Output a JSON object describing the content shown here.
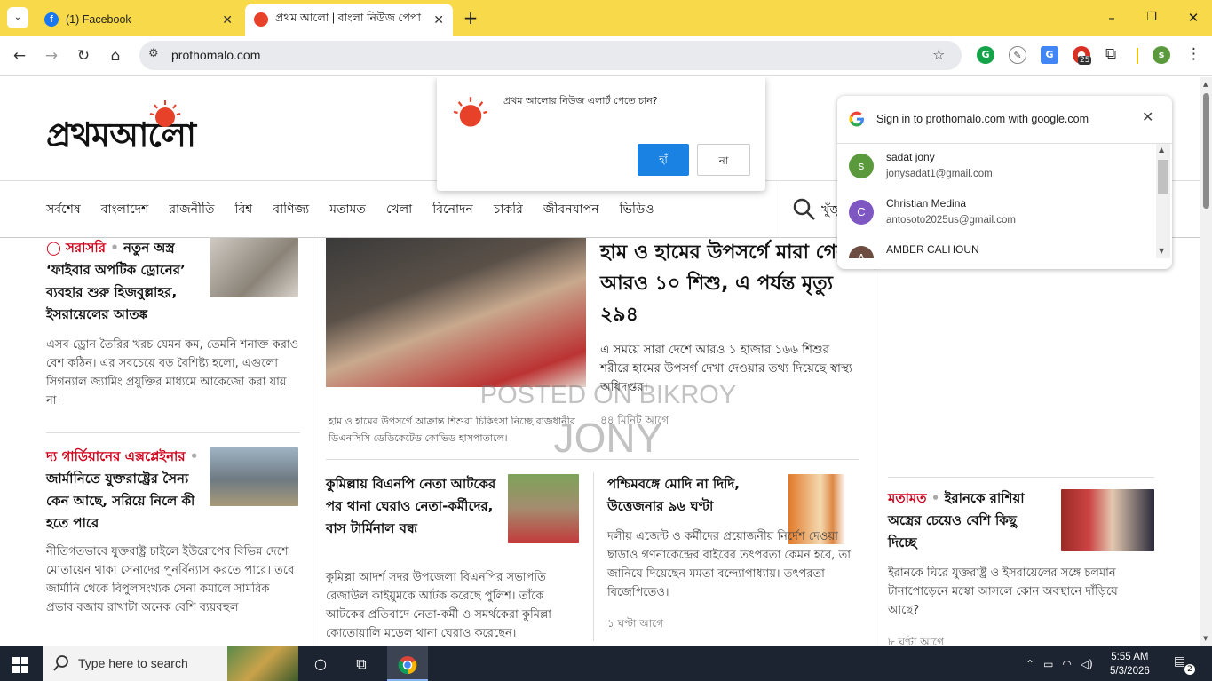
{
  "browser": {
    "tabs": [
      {
        "title": "(1) Facebook",
        "active": false
      },
      {
        "title": "প্রথম আলো | বাংলা নিউজ পেপা",
        "active": true
      }
    ],
    "url": "prothomalo.com",
    "profile_initial": "s",
    "ext_badge": "25"
  },
  "site": {
    "logo": "প্রথমআলো",
    "nav": [
      "সর্বশেষ",
      "বাংলাদেশ",
      "রাজনীতি",
      "বিশ্ব",
      "বাণিজ্য",
      "মতামত",
      "খেলা",
      "বিনোদন",
      "চাকরি",
      "জীবনযাপন",
      "ভিডিও"
    ],
    "search_label": "খুঁজু"
  },
  "notification": {
    "text": "প্রথম আলোর নিউজ এলার্ট পেতে চান?",
    "yes": "হাঁ",
    "no": "না"
  },
  "google_signin": {
    "title": "Sign in to prothomalo.com with google.com",
    "accounts": [
      {
        "initial": "s",
        "name": "sadat jony",
        "email": "jonysadat1@gmail.com",
        "color": "#5b9a3c"
      },
      {
        "initial": "C",
        "name": "Christian Medina",
        "email": "antosoto2025us@gmail.com",
        "color": "#7e57c2"
      },
      {
        "initial": "A",
        "name": "AMBER CALHOUN",
        "email": "",
        "color": "#6d4c41"
      }
    ]
  },
  "articles": {
    "left1": {
      "tag": "সরাসরি",
      "headline": "নতুন অস্ত্র ‘ফাইবার অপটিক ড্রোনের’ ব্যবহার শুরু হিজবুল্লাহর, ইসরায়েলের আতঙ্ক",
      "body": "এসব ড্রোন তৈরির খরচ যেমন কম, তেমনি শনাক্ত করাও বেশ কঠিন। এর সবচেয়ে বড় বৈশিষ্ট্য হলো, এগুলো সিগন্যাল জ্যামিং প্রযুক্তির মাধ্যমে আকেজো করা যায় না।"
    },
    "left2": {
      "tag": "দ্য গার্ডিয়ানের এক্সপ্লেইনার",
      "headline": "জার্মানিতে যুক্তরাষ্ট্রের সৈন্য কেন আছে, সরিয়ে নিলে কী হতে পারে",
      "body": "নীতিগতভাবে যুক্তরাষ্ট্র চাইলে ইউরোপের বিভিন্ন দেশে মোতায়েন থাকা সেনাদের পুনর্বিন্যাস করতে পারে। তবে জার্মানি থেকে বিপুলসংখ্যক সেনা কমালে সামরিক প্রভাব বজায় রাখাটা অনেক বেশি ব্যয়বহুল"
    },
    "lead": {
      "headline": "হাম ও হামের উপসর্গে মারা গেল আরও ১০ শিশু, এ পর্যন্ত মৃত্যু ২৯৪",
      "body": "এ সময়ে সারা দেশে আরও ১ হাজার ১৬৬ শিশুর শরীরে হামের উপসর্গ দেখা দেওয়ার তথ্য দিয়েছে স্বাস্থ্য অধিদপ্তর।",
      "caption": "হাম ও হামের উপসর্গে আক্রান্ত শিশুরা চিকিৎসা নিচ্ছে রাজধানীর ডিএনসিসি ডেডিকেটেড কোভিড হাসপাতালে।",
      "time": "৪৪ মিনিট আগে"
    },
    "mid1": {
      "headline": "কুমিল্লায় বিএনপি নেতা আটকের পর থানা ঘেরাও নেতা-কর্মীদের, বাস টার্মিনাল বন্ধ",
      "body": "কুমিল্লা আদর্শ সদর উপজেলা বিএনপির সভাপতি রেজাউল কাইয়ুমকে আটক করেছে পুলিশ। তাঁকে আটকের প্রতিবাদে নেতা-কর্মী ও সমর্থকেরা কুমিল্লা কোতোয়ালি মডেল থানা ঘেরাও করেছেন।"
    },
    "mid2": {
      "headline": "পশ্চিমবঙ্গে মোদি না দিদি, উত্তেজনার ৯৬ ঘণ্টা",
      "body": "দলীয় এজেন্ট ও কর্মীদের প্রয়োজনীয় নির্দেশ দেওয়া ছাড়াও গণনাকেন্দ্রের বাইরের তৎপরতা কেমন হবে, তা জানিয়ে দিয়েছেন মমতা বন্দ্যোপাধ্যায়। তৎপরতা বিজেপিতেও।",
      "time": "১ ঘণ্টা আগে"
    },
    "right1": {
      "tag": "মতামত",
      "headline": "ইরানকে রাশিয়া অস্ত্রের চেয়েও বেশি কিছু দিচ্ছে",
      "body": "ইরানকে ঘিরে যুক্তরাষ্ট্র ও ইসরায়েলের সঙ্গে চলমান টানাপোড়েনে মস্কো আসলে কোন অবস্থানে দাঁড়িয়ে আছে?",
      "time": "৮ ঘণ্টা আগে"
    }
  },
  "watermark": {
    "line1": "POSTED ON BIKROY",
    "line2": "JONY"
  },
  "taskbar": {
    "search_placeholder": "Type here to search",
    "time": "5:55 AM",
    "date": "5/3/2026",
    "notif_count": "2"
  }
}
